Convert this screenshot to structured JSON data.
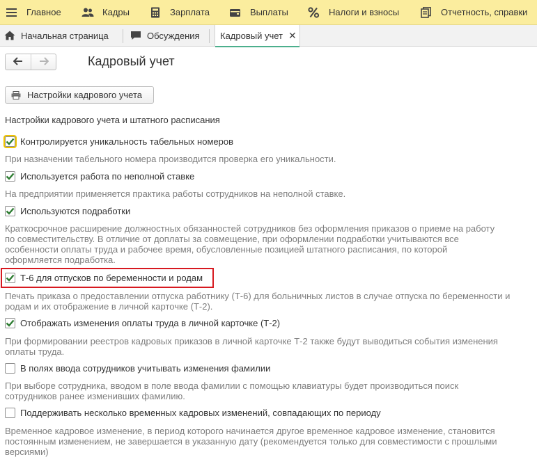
{
  "menu": {
    "items": [
      {
        "label": "Главное",
        "icon": "hamburger-menu-icon"
      },
      {
        "label": "Кадры",
        "icon": "people-icon"
      },
      {
        "label": "Зарплата",
        "icon": "calculator-icon"
      },
      {
        "label": "Выплаты",
        "icon": "wallet-icon"
      },
      {
        "label": "Налоги и взносы",
        "icon": "percent-icon"
      },
      {
        "label": "Отчетность, справки",
        "icon": "report-icon"
      }
    ]
  },
  "tabs": [
    {
      "label": "Начальная страница",
      "icon": "home-icon"
    },
    {
      "label": "Обсуждения",
      "icon": "chat-icon"
    },
    {
      "label": "Кадровый учет",
      "active": true
    }
  ],
  "page": {
    "title": "Кадровый учет",
    "settings_button": "Настройки кадрового учета",
    "section_title": "Настройки кадрового учета и штатного расписания"
  },
  "options": [
    {
      "label": "Контролируется уникальность табельных номеров",
      "checked": true,
      "description": "При назначении табельного номера производится проверка его уникальности."
    },
    {
      "label": "Используется работа по неполной ставке",
      "checked": true,
      "description": "На предприятии применяется практика работы сотрудников на неполной ставке."
    },
    {
      "label": "Используются подработки",
      "checked": true,
      "description": "Краткосрочное расширение должностных обязанностей сотрудников без оформления приказов о приеме на работу по совместительству. В отличие от доплаты за совмещение, при оформлении подработки учитываются все особенности оплаты труда и рабочее время, обусловленные позицией штатного расписания, по которой оформляется подработка."
    },
    {
      "label": "Т-6 для отпусков по беременности и родам",
      "checked": true,
      "description": "Печать приказа о предоставлении отпуска работнику (Т-6) для больничных листов в случае отпуска по беременности и родам и их отображение в личной карточке (Т-2)."
    },
    {
      "label": "Отображать изменения оплаты труда в личной карточке (Т-2)",
      "checked": true,
      "description": "При формировании реестров кадровых приказов в личной карточке Т-2 также будут выводиться события изменения оплаты труда."
    },
    {
      "label": "В полях ввода сотрудников учитывать изменения фамилии",
      "checked": false,
      "description": "При выборе сотрудника, вводом в поле ввода фамилии с помощью клавиатуры будет производиться поиск сотрудников ранее изменивших фамилию."
    },
    {
      "label": "Поддерживать несколько временных кадровых изменений, совпадающих по периоду",
      "checked": false,
      "description": "Временное кадровое изменение, в период которого начинается другое временное кадровое изменение, становится постоянным изменением, не завершается в указанную дату (рекомендуется только для совместимости с прошлыми версиями)"
    }
  ],
  "colors": {
    "menu_bg": "#fbed9e",
    "check": "#2e7d32",
    "highlight": "#d71920",
    "tab_underline": "#4caf8d"
  }
}
